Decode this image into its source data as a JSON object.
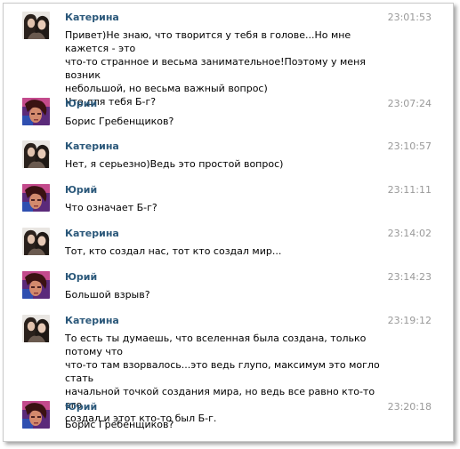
{
  "messages": [
    {
      "author": "Катерина",
      "time": "23:01:53",
      "avatar": "katerina-photo",
      "text": "Привет)Не знаю, что творится у тебя в голове...Но мне кажется - это\nчто-то странное и весьма занимательное!Поэтому у меня возник\nнебольшой, но весьма важный вопрос)\nЧто для тебя Б-г?"
    },
    {
      "author": "Юрий",
      "time": "23:07:24",
      "avatar": "yuri-photo",
      "text": "Борис Гребенщиков?"
    },
    {
      "author": "Катерина",
      "time": "23:10:57",
      "avatar": "katerina-photo",
      "text": "Нет, я серьезно)Ведь это простой вопрос)"
    },
    {
      "author": "Юрий",
      "time": "23:11:11",
      "avatar": "yuri-photo",
      "text": "Что означает Б-г?"
    },
    {
      "author": "Катерина",
      "time": "23:14:02",
      "avatar": "katerina-photo",
      "text": "Тот, кто создал нас, тот кто создал мир..."
    },
    {
      "author": "Юрий",
      "time": "23:14:23",
      "avatar": "yuri-photo",
      "text": "Большой взрыв?"
    },
    {
      "author": "Катерина",
      "time": "23:19:12",
      "avatar": "katerina-photo",
      "text": "То есть ты думаешь, что вселенная была создана, только потому что\nчто-то там взорвалось...это ведь глупо, максимум это могло стать\nначальной точкой создания мира, но ведь все равно кто-то его\nсоздал и этот кто-то был Б-г."
    },
    {
      "author": "Юрий",
      "time": "23:20:18",
      "avatar": "yuri-photo",
      "text": "Борис Гребенщиков?"
    }
  ]
}
